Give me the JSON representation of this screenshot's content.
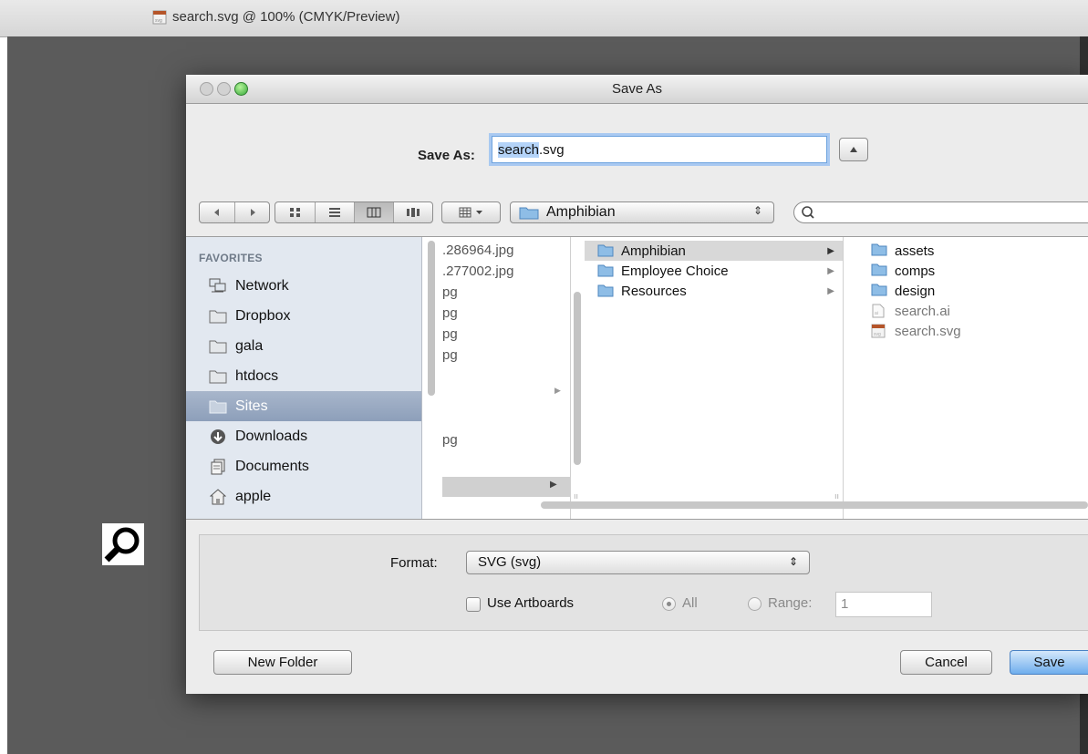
{
  "document": {
    "tab_title": "search.svg @ 100% (CMYK/Preview)",
    "tab_icon": "svg-file-icon"
  },
  "dialog": {
    "title": "Save As",
    "save_as_label": "Save As:",
    "filename_selected": "search",
    "filename_rest": ".svg",
    "location": "Amphibian"
  },
  "sidebar": {
    "heading": "FAVORITES",
    "items": [
      {
        "label": "Network",
        "icon": "network-icon"
      },
      {
        "label": "Dropbox",
        "icon": "folder-icon"
      },
      {
        "label": "gala",
        "icon": "folder-icon"
      },
      {
        "label": "htdocs",
        "icon": "folder-icon"
      },
      {
        "label": "Sites",
        "icon": "folder-icon",
        "selected": true
      },
      {
        "label": "Downloads",
        "icon": "downloads-icon"
      },
      {
        "label": "Documents",
        "icon": "documents-icon"
      },
      {
        "label": "apple",
        "icon": "home-icon"
      }
    ]
  },
  "column1": {
    "rows": [
      ".286964.jpg",
      ".277002.jpg",
      "pg",
      "pg",
      "pg",
      "pg",
      "pg"
    ]
  },
  "column2": {
    "rows": [
      {
        "label": "Amphibian",
        "selected": true
      },
      {
        "label": "Employee Choice"
      },
      {
        "label": "Resources"
      }
    ]
  },
  "column3": {
    "rows": [
      {
        "label": "assets",
        "icon": "folder-icon"
      },
      {
        "label": "comps",
        "icon": "folder-icon"
      },
      {
        "label": "design",
        "icon": "folder-icon"
      },
      {
        "label": "search.ai",
        "icon": "ai-file-icon",
        "dim": true
      },
      {
        "label": "search.svg",
        "icon": "svg-file-icon",
        "dim": true
      }
    ]
  },
  "options": {
    "format_label": "Format:",
    "format_value": "SVG (svg)",
    "use_artboards_label": "Use Artboards",
    "all_label": "All",
    "range_label": "Range:",
    "range_value": "1"
  },
  "buttons": {
    "new_folder": "New Folder",
    "cancel": "Cancel",
    "save": "Save"
  },
  "colors": {
    "canvas": "#5b5b5b",
    "focus_ring": "#a9c9f1",
    "sidebar_selected": "#8d9fba",
    "folder_blue": "#7fb3e0"
  }
}
